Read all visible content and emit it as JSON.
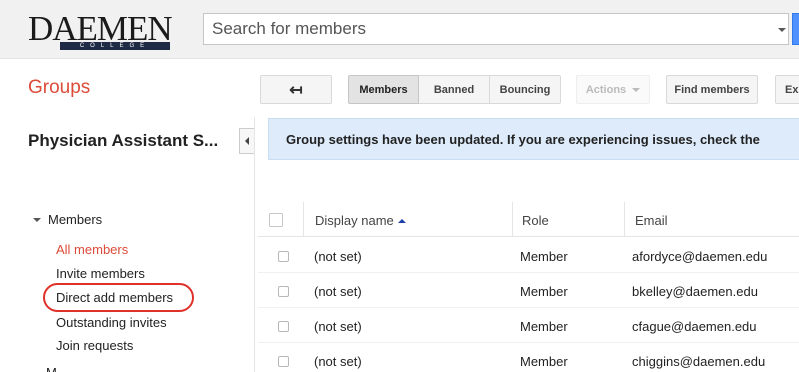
{
  "logo": {
    "word": "DAEMEN",
    "sub": "COLLEGE"
  },
  "search": {
    "placeholder": "Search for members"
  },
  "header": {
    "title": "Groups"
  },
  "toolbar": {
    "members_label": "Members",
    "banned_label": "Banned",
    "bouncing_label": "Bouncing",
    "actions_label": "Actions",
    "find_members_label": "Find members",
    "extra_label": "Ex"
  },
  "sidebar": {
    "group_name": "Physician Assistant S...",
    "section_label": "Members",
    "items": [
      {
        "label": "All members"
      },
      {
        "label": "Invite members"
      },
      {
        "label": "Direct add members"
      },
      {
        "label": "Outstanding invites"
      },
      {
        "label": "Join requests"
      }
    ],
    "next_section_partial": "M"
  },
  "notice": {
    "text": "Group settings have been updated. If you are experiencing issues, check the"
  },
  "table": {
    "columns": [
      "Display name",
      "Role",
      "Email"
    ],
    "rows": [
      {
        "name": "(not set)",
        "role": "Member",
        "email": "afordyce@daemen.edu"
      },
      {
        "name": "(not set)",
        "role": "Member",
        "email": "bkelley@daemen.edu"
      },
      {
        "name": "(not set)",
        "role": "Member",
        "email": "cfague@daemen.edu"
      },
      {
        "name": "(not set)",
        "role": "Member",
        "email": "chiggins@daemen.edu"
      }
    ]
  },
  "colors": {
    "accent_red": "#dd4b39",
    "notice_bg": "#ddebfb",
    "highlight_circle": "#e0302a"
  }
}
